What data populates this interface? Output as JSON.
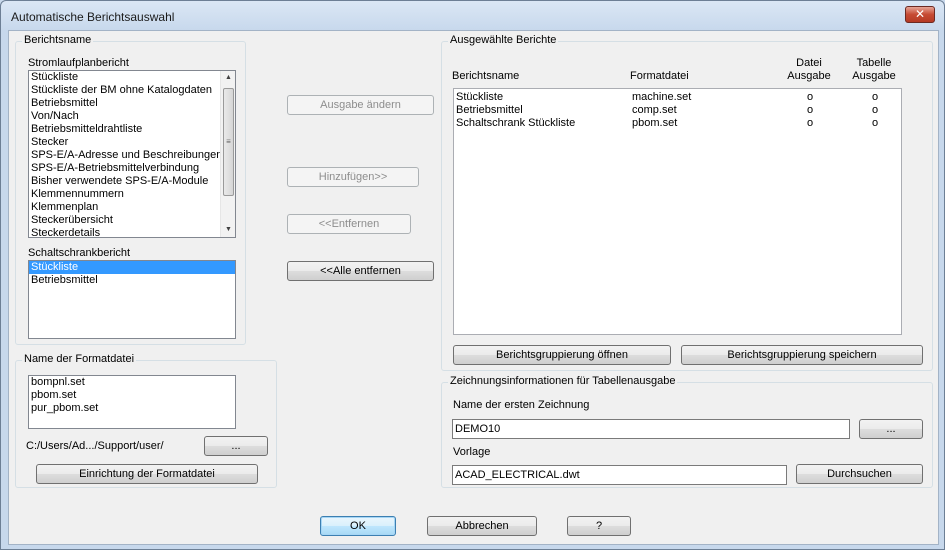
{
  "window": {
    "title": "Automatische Berichtsauswahl",
    "close_glyph": "✕"
  },
  "left_group": {
    "legend": "Berichtsname"
  },
  "schematic": {
    "label": "Stromlaufplanbericht",
    "items": [
      "Stückliste",
      "Stückliste der BM ohne Katalogdaten",
      "Betriebsmittel",
      "Von/Nach",
      "Betriebsmitteldrahtliste",
      "Stecker",
      "SPS-E/A-Adresse und Beschreibungen",
      "SPS-E/A-Betriebsmittelverbindung",
      "Bisher verwendete SPS-E/A-Module",
      "Klemmennummern",
      "Klemmenplan",
      "Steckerübersicht",
      "Steckerdetails"
    ]
  },
  "panel": {
    "label": "Schaltschrankbericht",
    "items": [
      "Stückliste",
      "Betriebsmittel"
    ],
    "selected_index": 0
  },
  "format_group": {
    "legend": "Name der Formatdatei",
    "items": [
      "bompnl.set",
      "pbom.set",
      "pur_pbom.set"
    ],
    "path": "C:/Users/Ad.../Support/user/",
    "browse_label": "...",
    "setup_label": "Einrichtung der Formatdatei"
  },
  "middle": {
    "change_output": "Ausgabe ändern",
    "add": "Hinzufügen>>",
    "remove": "<<Entfernen",
    "remove_all": "<<Alle entfernen"
  },
  "selected_group": {
    "legend": "Ausgewählte Berichte",
    "columns": {
      "name": "Berichtsname",
      "format": "Formatdatei",
      "file_line1": "Datei",
      "file_line2": "Ausgabe",
      "table_line1": "Tabelle",
      "table_line2": "Ausgabe"
    },
    "rows": [
      {
        "name": "Stückliste",
        "format": "machine.set",
        "file": "o",
        "table": "o"
      },
      {
        "name": "Betriebsmittel",
        "format": "comp.set",
        "file": "o",
        "table": "o"
      },
      {
        "name": "Schaltschrank Stückliste",
        "format": "pbom.set",
        "file": "o",
        "table": "o"
      }
    ],
    "open_group_label": "Berichtsgruppierung öffnen",
    "save_group_label": "Berichtsgruppierung speichern"
  },
  "drawing_group": {
    "legend": "Zeichnungsinformationen für Tabellenausgabe",
    "first_drawing_label": "Name der ersten Zeichnung",
    "first_drawing_value": "DEMO10",
    "first_drawing_browse": "...",
    "template_label": "Vorlage",
    "template_value": "ACAD_ELECTRICAL.dwt",
    "template_browse": "Durchsuchen"
  },
  "footer": {
    "ok": "OK",
    "cancel": "Abbrechen",
    "help": "?"
  }
}
